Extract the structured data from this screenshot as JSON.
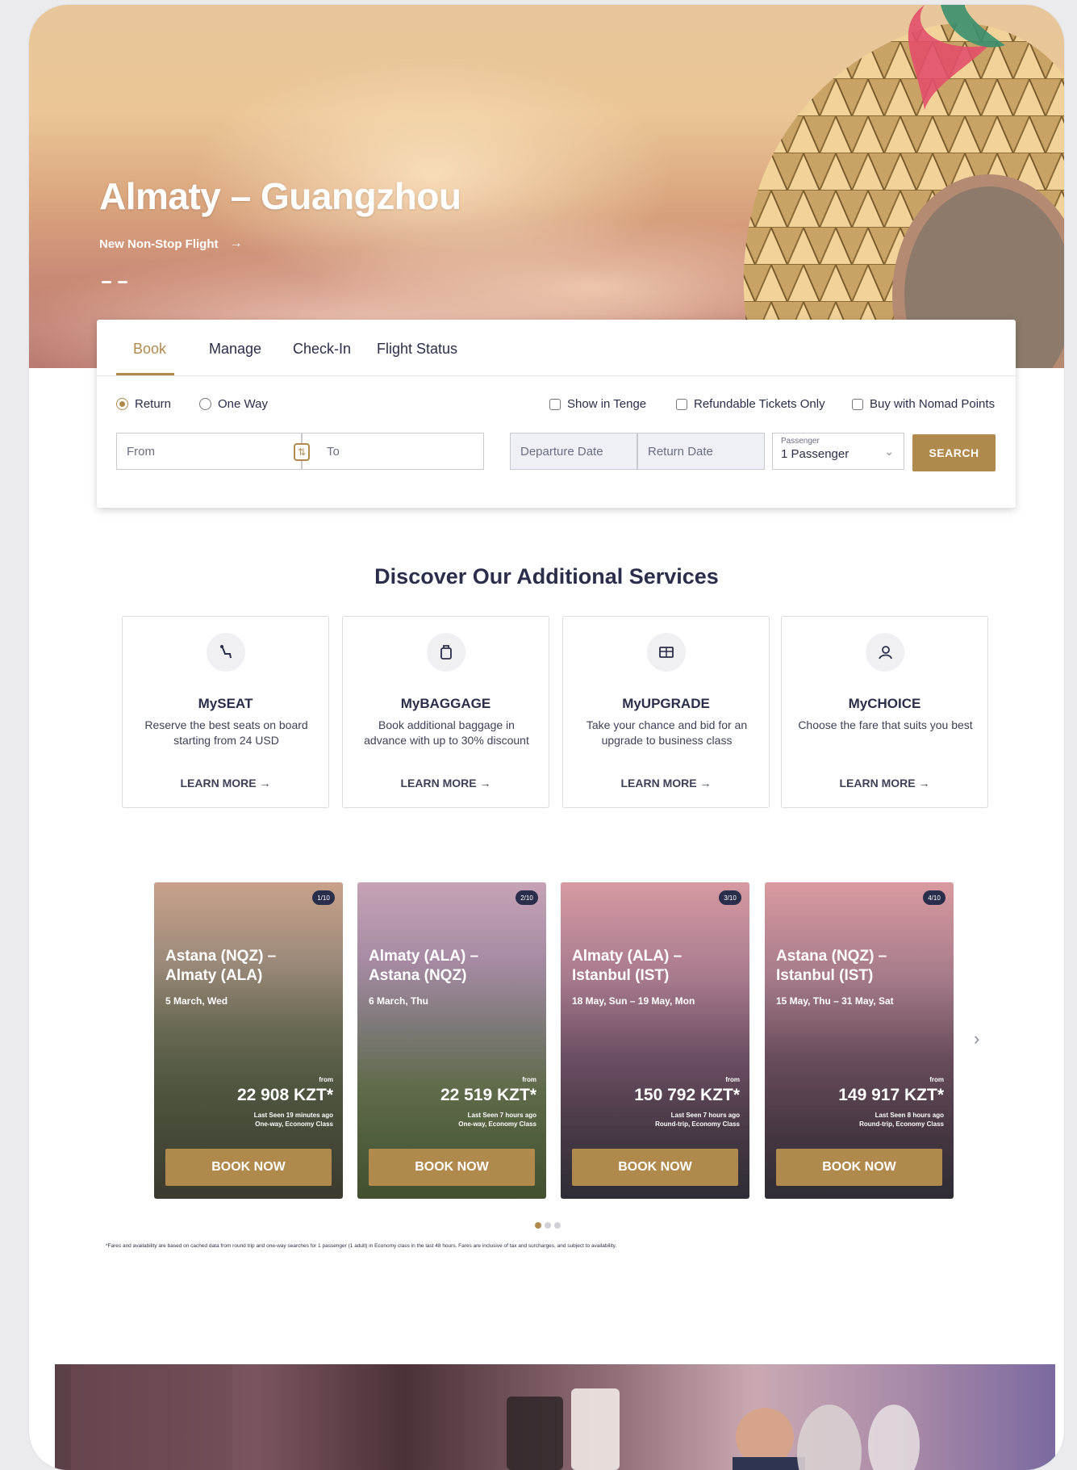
{
  "hero": {
    "title": "Almaty – Guangzhou",
    "link_label": "New Non-Stop Flight",
    "link_arrow": "→"
  },
  "booking": {
    "tabs": [
      "Book",
      "Manage",
      "Check-In",
      "Flight Status"
    ],
    "trip_types": [
      "Return",
      "One Way"
    ],
    "selected_trip_type": "Return",
    "checkboxes": [
      "Show in Tenge",
      "Refundable Tickets Only",
      "Buy with Nomad Points"
    ],
    "from_placeholder": "From",
    "to_placeholder": "To",
    "departure_placeholder": "Departure Date",
    "return_placeholder": "Return Date",
    "passengers_label": "Passenger",
    "passengers_value": "1 Passenger",
    "search_label": "SEARCH"
  },
  "services": {
    "title": "Discover Our Additional Services",
    "items": [
      {
        "name": "MySEAT",
        "desc": "Reserve the best seats on board starting from 24 USD",
        "more": "LEARN MORE →",
        "icon": "seat-icon"
      },
      {
        "name": "MyBAGGAGE",
        "desc": "Book additional baggage in advance with up to 30% discount",
        "more": "LEARN MORE →",
        "icon": "baggage-icon"
      },
      {
        "name": "MyUPGRADE",
        "desc": "Take your chance and bid for an upgrade to business class",
        "more": "LEARN MORE →",
        "icon": "upgrade-icon"
      },
      {
        "name": "MyCHOICE",
        "desc": "Choose the fare that suits you best",
        "more": "LEARN MORE →",
        "icon": "choice-icon"
      }
    ]
  },
  "offers": {
    "items": [
      {
        "badge": "1/10",
        "route": "Astana (NQZ) – Almaty (ALA)",
        "dates": "5 March, Wed",
        "from": "from",
        "price": "22 908 KZT*",
        "seen": "Last Seen 19 minutes ago",
        "type": "One-way, Economy Class",
        "book": "BOOK NOW"
      },
      {
        "badge": "2/10",
        "route": "Almaty (ALA) – Astana (NQZ)",
        "dates": "6 March, Thu",
        "from": "from",
        "price": "22 519 KZT*",
        "seen": "Last Seen 7 hours ago",
        "type": "One-way, Economy Class",
        "book": "BOOK NOW"
      },
      {
        "badge": "3/10",
        "route": "Almaty (ALA) – Istanbul (IST)",
        "dates": "18 May, Sun – 19 May, Mon",
        "from": "from",
        "price": "150 792 KZT*",
        "seen": "Last Seen 7 hours ago",
        "type": "Round-trip, Economy Class",
        "book": "BOOK NOW"
      },
      {
        "badge": "4/10",
        "route": "Astana (NQZ) – Istanbul (IST)",
        "dates": "15 May, Thu – 31 May, Sat",
        "from": "from",
        "price": "149 917 KZT*",
        "seen": "Last Seen 8 hours ago",
        "type": "Round-trip, Economy Class",
        "book": "BOOK NOW"
      }
    ],
    "next": "›",
    "disclaimer": "*Fares and availability are based on cached data from round trip and one-way searches for 1 passenger (1 adult) in Economy class in the last 48 hours. Fares are inclusive of tax and surcharges, and subject to availability."
  },
  "colors": {
    "accent": "#b0894d",
    "navy": "#2b2e4a"
  }
}
